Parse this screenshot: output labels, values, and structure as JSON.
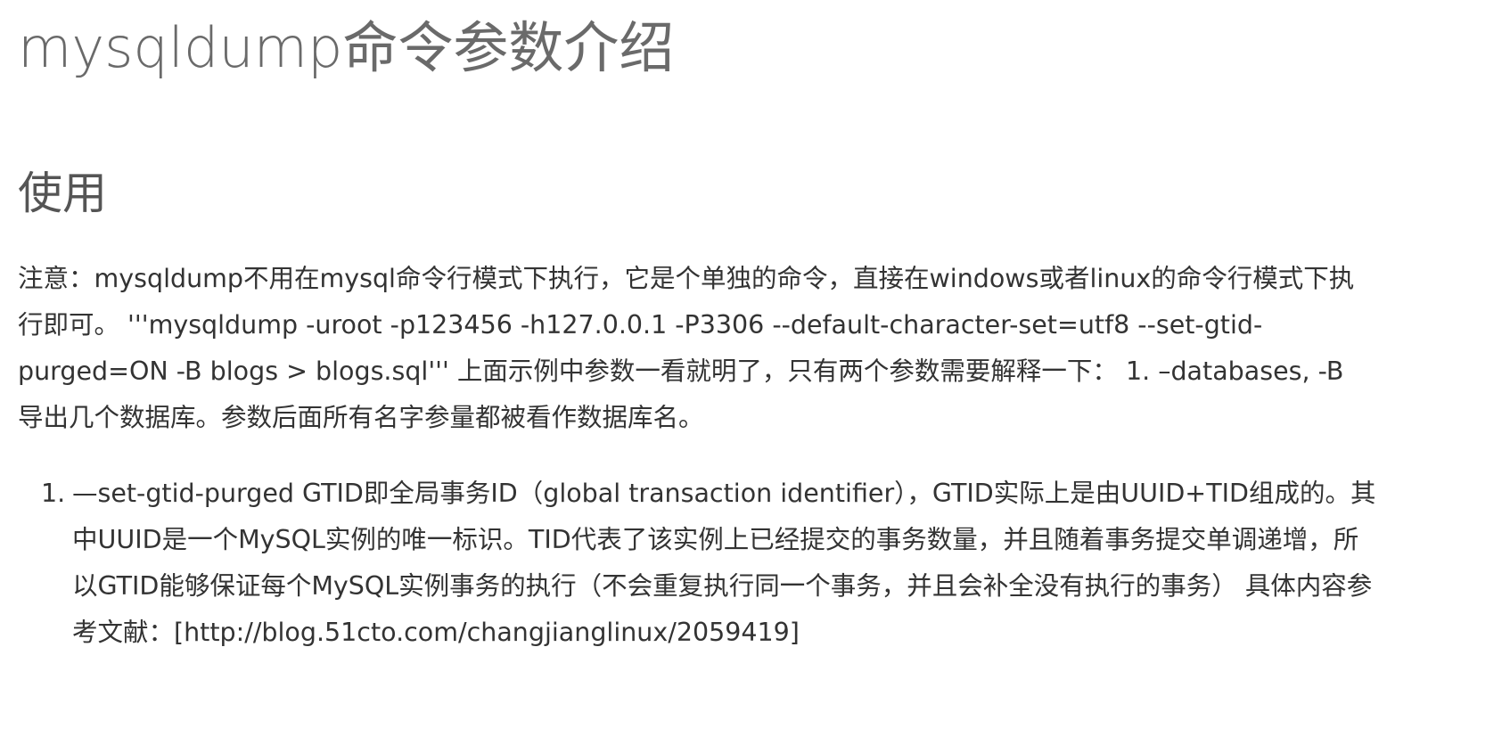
{
  "article": {
    "title": "mysqldump命令参数介绍",
    "section_heading": "使用",
    "paragraph": "注意：mysqldump不用在mysql命令行模式下执行，它是个单独的命令，直接在windows或者linux的命令行模式下执行即可。 '''mysqldump -uroot -p123456 -h127.0.0.1 -P3306 --default-character-set=utf8 --set-gtid-purged=ON -B blogs > blogs.sql''' 上面示例中参数一看就明了，只有两个参数需要解释一下： 1. –databases, -B 导出几个数据库。参数后面所有名字参量都被看作数据库名。",
    "list": [
      {
        "number": "1.",
        "text": "—set-gtid-purged GTID即全局事务ID（global transaction identifier），GTID实际上是由UUID+TID组成的。其中UUID是一个MySQL实例的唯一标识。TID代表了该实例上已经提交的事务数量，并且随着事务提交单调递增，所以GTID能够保证每个MySQL实例事务的执行（不会重复执行同一个事务，并且会补全没有执行的事务） 具体内容参考文献：[http://blog.51cto.com/changjianglinux/2059419]"
      }
    ]
  }
}
